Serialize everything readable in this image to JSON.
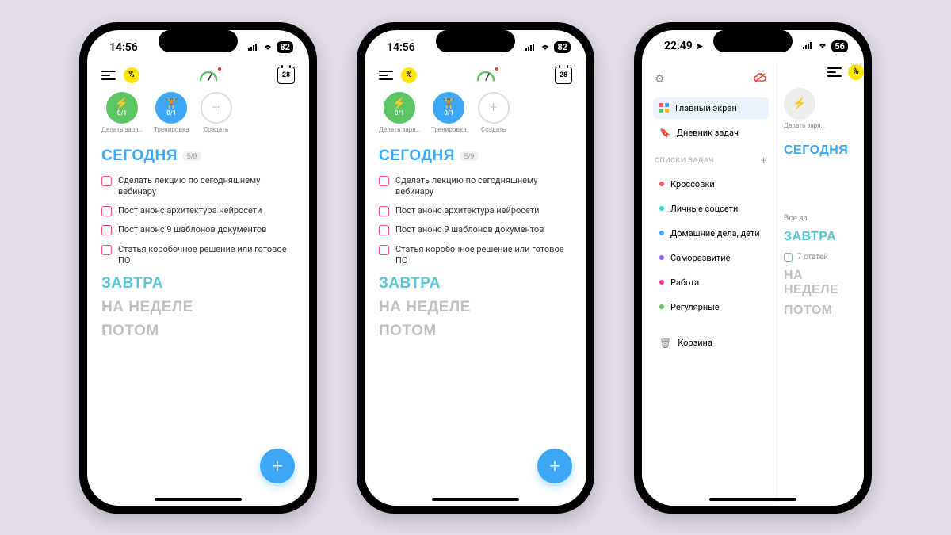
{
  "status_a": {
    "time": "14:56",
    "battery": "82"
  },
  "status_b": {
    "time": "22:49",
    "battery": "56"
  },
  "calendar_day": "28",
  "habits": [
    {
      "label": "Делать заря…",
      "sub": "0/1"
    },
    {
      "label": "Тренировка",
      "sub": "0/1"
    },
    {
      "label": "Создать"
    }
  ],
  "sections": {
    "today": "СЕГОДНЯ",
    "today_badge": "5/9",
    "tomorrow": "ЗАВТРА",
    "week": "НА НЕДЕЛЕ",
    "later": "ПОТОМ"
  },
  "tasks": [
    "Сделать лекцию по сегодняшнему вебинару",
    "Пост анонс архитектура нейросети",
    "Пост анонс 9 шаблонов документов",
    "Статья коробочное решение или готовое ПО"
  ],
  "sidebar": {
    "main_screen": "Главный экран",
    "task_diary": "Дневник задач",
    "lists_header": "СПИСКИ ЗАДАЧ",
    "trash": "Корзина",
    "lists": [
      {
        "color": "#ff4d6d",
        "label": "Кроссовки"
      },
      {
        "color": "#30d5c8",
        "label": "Личные соцсети"
      },
      {
        "color": "#3ba7f5",
        "label": "Домашние дела, дети"
      },
      {
        "color": "#8e5cff",
        "label": "Саморазвитие"
      },
      {
        "color": "#ff2d95",
        "label": "Работа"
      },
      {
        "color": "#5dc466",
        "label": "Регулярные"
      }
    ]
  },
  "phone3_main": {
    "habit_label": "Делать заря…",
    "all_label": "Все за",
    "task": "7 статей"
  }
}
